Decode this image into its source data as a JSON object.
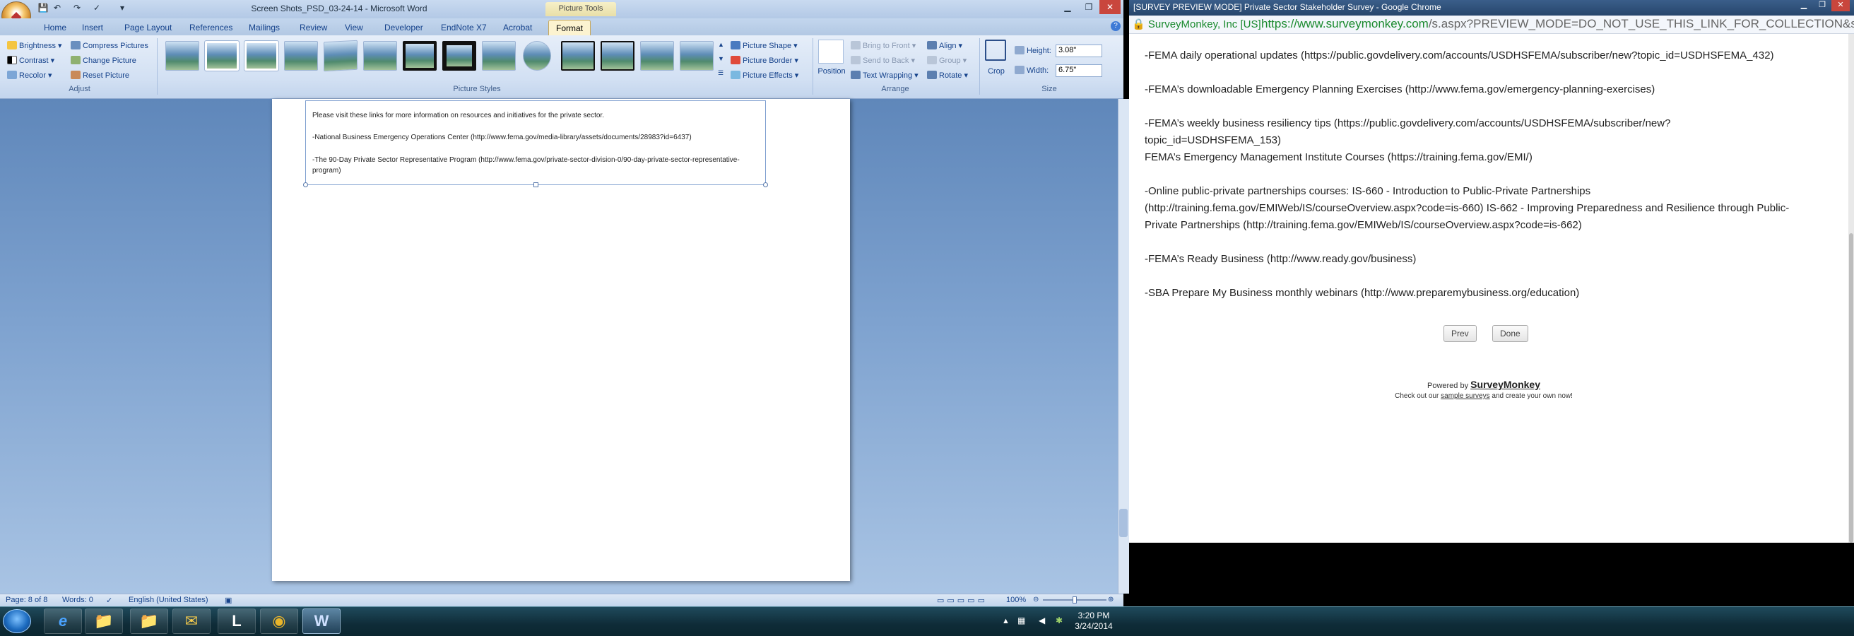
{
  "taskbar": {
    "start_icon": "windows-orb-icon",
    "apps": [
      {
        "name": "internet-explorer",
        "glyph": "e"
      },
      {
        "name": "file-explorer",
        "glyph": "📁"
      },
      {
        "name": "outlook",
        "glyph": "✉"
      },
      {
        "name": "lync",
        "glyph": "L"
      },
      {
        "name": "chrome",
        "glyph": "◉"
      },
      {
        "name": "word",
        "glyph": "W"
      }
    ],
    "clock_time": "3:20 PM",
    "clock_date": "3/24/2014"
  },
  "word": {
    "title": "Screen Shots_PSD_03-24-14 - Microsoft Word",
    "context_tools": "Picture Tools",
    "tabs": [
      "Home",
      "Insert",
      "Page Layout",
      "References",
      "Mailings",
      "Review",
      "View",
      "Developer",
      "EndNote X7",
      "Acrobat",
      "Format"
    ],
    "active_tab": "Format",
    "adjust": {
      "items": [
        "Brightness ▾",
        "Contrast ▾",
        "Recolor ▾",
        "Compress Pictures",
        "Change Picture",
        "Reset Picture"
      ],
      "label": "Adjust"
    },
    "picture_styles": {
      "label": "Picture Styles",
      "items": [
        "Picture Shape ▾",
        "Picture Border ▾",
        "Picture Effects ▾"
      ]
    },
    "arrange": {
      "label": "Arrange",
      "position": "Position",
      "items": [
        "Bring to Front ▾",
        "Send to Back ▾",
        "Text Wrapping ▾",
        "Align ▾",
        "Group ▾",
        "Rotate ▾"
      ]
    },
    "size": {
      "label": "Size",
      "crop": "Crop",
      "height_label": "Height:",
      "height_value": "3.08\"",
      "width_label": "Width:",
      "width_value": "6.75\""
    },
    "doc_lines": [
      "Please visit these links for more information on resources and initiatives for the private sector.",
      "-National Business Emergency Operations Center (http://www.fema.gov/media-library/assets/documents/28983?id=6437)",
      "-The 90-Day Private Sector Representative Program (http://www.fema.gov/private-sector-division-0/90-day-private-sector-representative-",
      "program)"
    ],
    "status": {
      "page": "Page: 8 of 8",
      "words": "Words: 0",
      "language": "English (United States)",
      "zoom": "100%"
    }
  },
  "chrome": {
    "title": "[SURVEY PREVIEW MODE] Private Sector Stakeholder Survey - Google Chrome",
    "ev_badge": "SurveyMonkey, Inc [US]",
    "url_host": "https://www.surveymonkey.com",
    "url_rest": "/s.aspx?PREVIEW_MODE=DO_NOT_USE_THIS_LINK_FOR_COLLECTION&sm=DaEBkAIW",
    "lines": [
      "-FEMA daily operational updates (https://public.govdelivery.com/accounts/USDHSFEMA/subscriber/new?topic_id=USDHSFEMA_432)",
      "-FEMA’s downloadable Emergency Planning Exercises (http://www.fema.gov/emergency-planning-exercises)",
      "-FEMA’s weekly business resiliency tips (https://public.govdelivery.com/accounts/USDHSFEMA/subscriber/new?",
      "topic_id=USDHSFEMA_153)",
      "FEMA’s Emergency Management Institute Courses (https://training.fema.gov/EMI/)",
      "-Online public-private partnerships courses: IS-660 - Introduction to Public-Private Partnerships",
      "(http://training.fema.gov/EMIWeb/IS/courseOverview.aspx?code=is-660) IS-662 - Improving Preparedness and Resilience through Public-",
      "Private Partnerships (http://training.fema.gov/EMIWeb/IS/courseOverview.aspx?code=is-662)",
      "-FEMA’s Ready Business (http://www.ready.gov/business)",
      "-SBA Prepare My Business monthly webinars (http://www.preparemybusiness.org/education)"
    ],
    "prev_button": "Prev",
    "done_button": "Done",
    "powered_prefix": "Powered by",
    "powered_brand": "SurveyMonkey",
    "checkout_prefix": "Check out our",
    "checkout_link": "sample surveys",
    "checkout_suffix": "and create your own now!"
  }
}
